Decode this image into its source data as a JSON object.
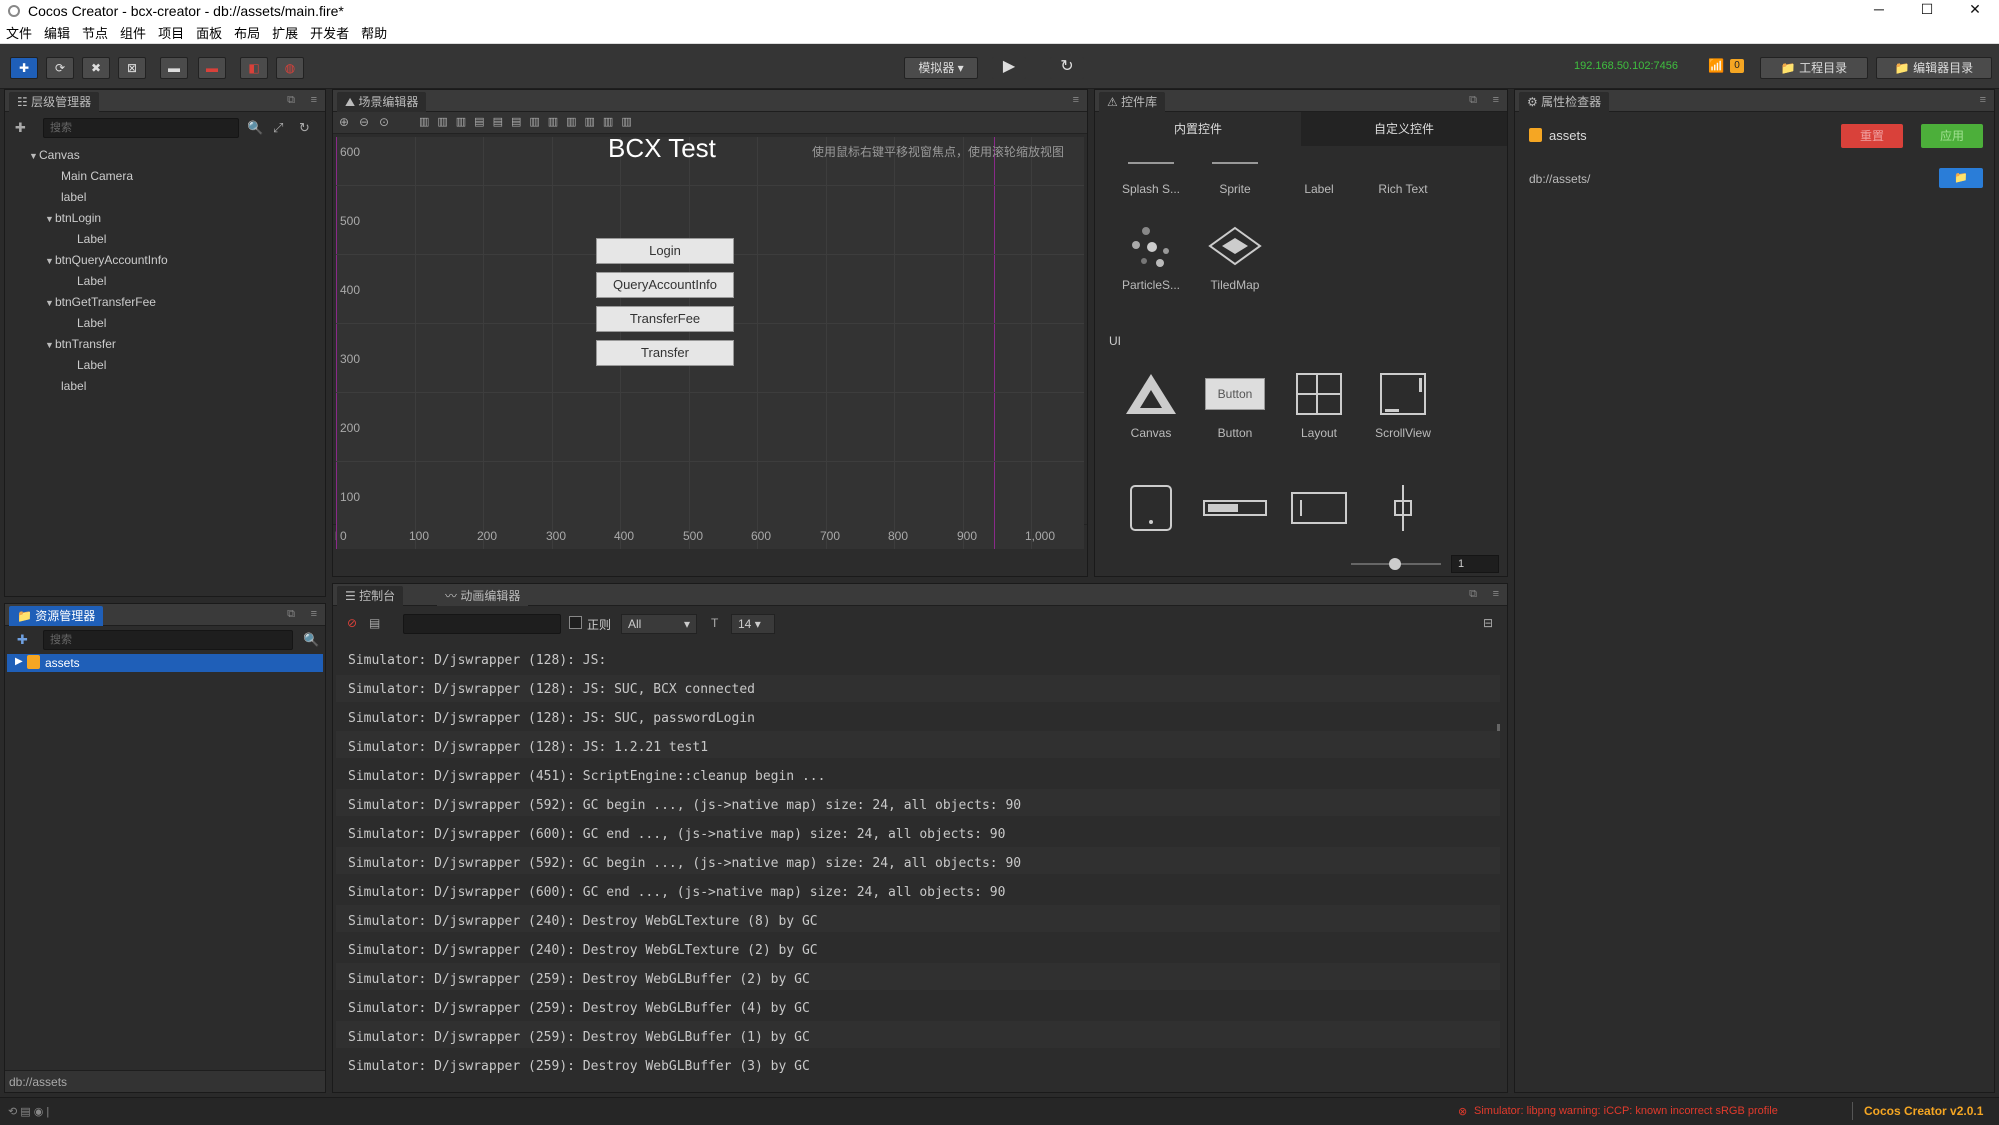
{
  "window": {
    "title": "Cocos Creator - bcx-creator - db://assets/main.fire*"
  },
  "menu": [
    "文件",
    "编辑",
    "节点",
    "组件",
    "项目",
    "面板",
    "布局",
    "扩展",
    "开发者",
    "帮助"
  ],
  "toolbar": {
    "preview_mode": "模拟器",
    "ip": "192.168.50.102:7456",
    "badge": "0",
    "project_dir": "工程目录",
    "editor_dir": "编辑器目录"
  },
  "hierarchy": {
    "title": "层级管理器",
    "search_placeholder": "搜索",
    "items": [
      {
        "label": "Canvas"
      },
      {
        "label": "Main Camera"
      },
      {
        "label": "label"
      },
      {
        "label": "btnLogin"
      },
      {
        "label": "Label"
      },
      {
        "label": "btnQueryAccountInfo"
      },
      {
        "label": "Label"
      },
      {
        "label": "btnGetTransferFee"
      },
      {
        "label": "Label"
      },
      {
        "label": "btnTransfer"
      },
      {
        "label": "Label"
      },
      {
        "label": "label"
      }
    ]
  },
  "assets": {
    "title": "资源管理器",
    "search_placeholder": "搜索",
    "root": "assets",
    "footer": "db://assets"
  },
  "scene": {
    "title": "场景编辑器",
    "heading": "BCX Test",
    "hint": "使用鼠标右键平移视窗焦点，使用滚轮缩放视图",
    "y_ticks": [
      "600",
      "500",
      "400",
      "300",
      "200",
      "100"
    ],
    "x_ticks": [
      "0",
      "100",
      "200",
      "300",
      "400",
      "500",
      "600",
      "700",
      "800",
      "900",
      "1,000"
    ],
    "buttons": [
      "Login",
      "QueryAccountInfo",
      "TransferFee",
      "Transfer"
    ],
    "footer": "button"
  },
  "widgets": {
    "title": "控件库",
    "tab_builtin": "内置控件",
    "tab_custom": "自定义控件",
    "row1": [
      "Splash S...",
      "Sprite",
      "Label",
      "Rich Text"
    ],
    "row2": [
      "ParticleS...",
      "TiledMap"
    ],
    "section_ui": "UI",
    "row3": [
      "Canvas",
      "Button",
      "Layout",
      "ScrollView"
    ],
    "button_icon_text": "Button",
    "zoom_value": "1"
  },
  "inspector": {
    "title": "属性检查器",
    "asset_name": "assets",
    "reset_label": "重置",
    "apply_label": "应用",
    "path": "db://assets/"
  },
  "console": {
    "tab_console": "控制台",
    "tab_animation": "动画编辑器",
    "regex_label": "正则",
    "filter": "All",
    "font_size": "14",
    "lines": [
      "Simulator: D/jswrapper (128): JS:",
      "Simulator: D/jswrapper (128): JS: SUC, BCX connected",
      "Simulator: D/jswrapper (128): JS: SUC, passwordLogin",
      "Simulator: D/jswrapper (128): JS: 1.2.21 test1",
      "Simulator: D/jswrapper (451): ScriptEngine::cleanup begin ...",
      "Simulator: D/jswrapper (592): GC begin ..., (js->native map) size: 24, all objects: 90",
      "Simulator: D/jswrapper (600): GC end ..., (js->native map) size: 24, all objects: 90",
      "Simulator: D/jswrapper (592): GC begin ..., (js->native map) size: 24, all objects: 90",
      "Simulator: D/jswrapper (600): GC end ..., (js->native map) size: 24, all objects: 90",
      "Simulator: D/jswrapper (240): Destroy WebGLTexture (8) by GC",
      "Simulator: D/jswrapper (240): Destroy WebGLTexture (2) by GC",
      "Simulator: D/jswrapper (259): Destroy WebGLBuffer (2) by GC",
      "Simulator: D/jswrapper (259): Destroy WebGLBuffer (4) by GC",
      "Simulator: D/jswrapper (259): Destroy WebGLBuffer (1) by GC",
      "Simulator: D/jswrapper (259): Destroy WebGLBuffer (3) by GC"
    ]
  },
  "statusbar": {
    "warning": "Simulator: libpng warning: iCCP: known incorrect sRGB profile",
    "version": "Cocos Creator v2.0.1"
  },
  "colors": {
    "accent": "#1f5fb8",
    "reset": "#d9413a",
    "apply": "#4caf3a",
    "ip": "#3fbf3f",
    "warning": "#e23a2c",
    "version": "#f5a623"
  }
}
